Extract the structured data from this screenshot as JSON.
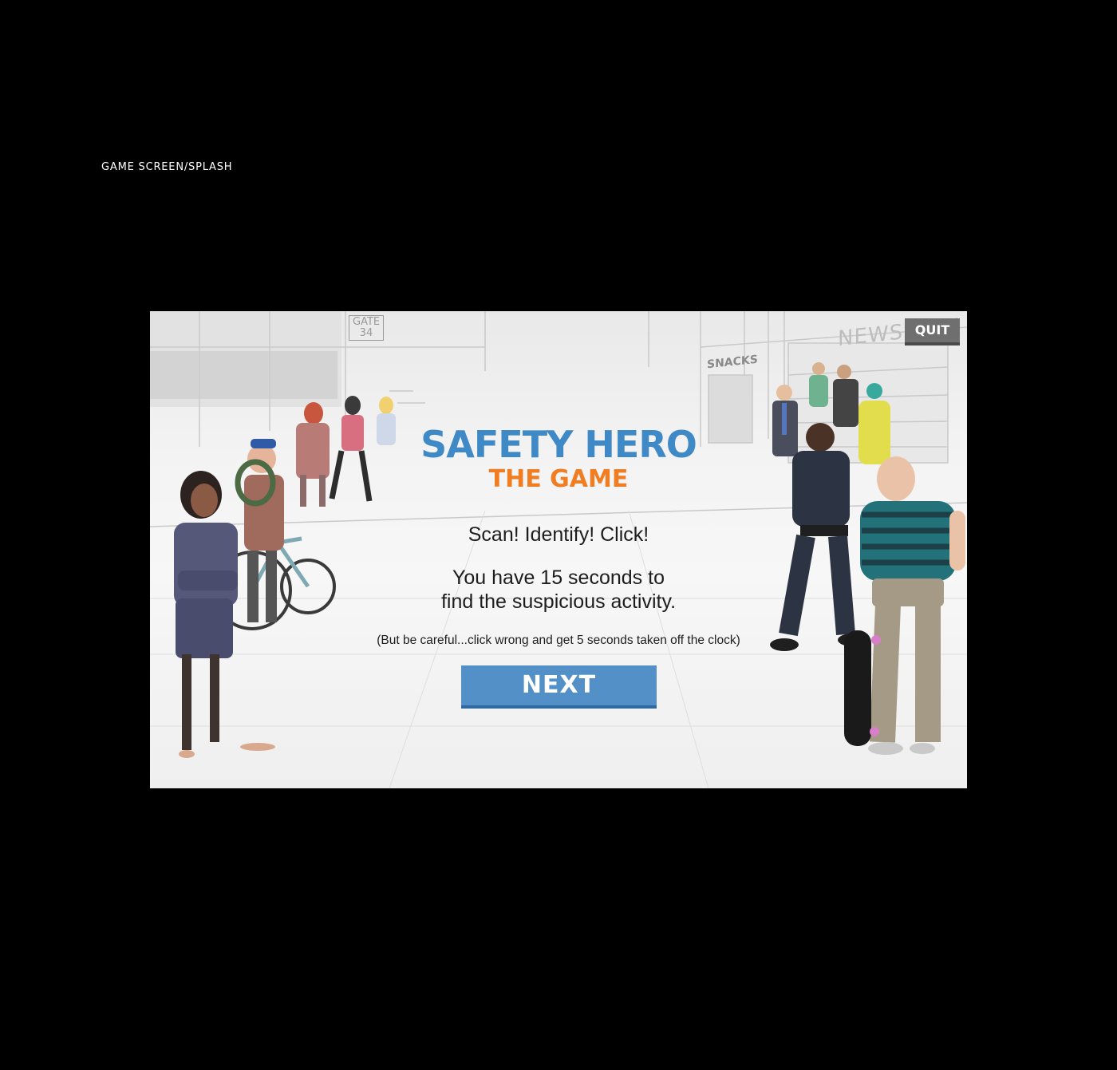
{
  "page_label": "GAME SCREEN/SPLASH",
  "game": {
    "title": "SAFETY HERO",
    "subtitle": "THE GAME",
    "tagline": "Scan! Identify! Click!",
    "instructions": [
      "You have 15 seconds to",
      "find the suspicious activity."
    ],
    "note": "(But be careful...click wrong and get 5 seconds taken off the clock)",
    "next_label": "NEXT",
    "quit_label": "QUIT",
    "signs": {
      "gate_line1": "GATE",
      "gate_line2": "34",
      "snacks": "SNACKS",
      "newsstand": "NEWSSTAN"
    },
    "colors": {
      "title_blue": "#3f8ac6",
      "subtitle_orange": "#f07d22",
      "next_button": "#5390c7",
      "quit_button": "#6f6f6f"
    }
  }
}
